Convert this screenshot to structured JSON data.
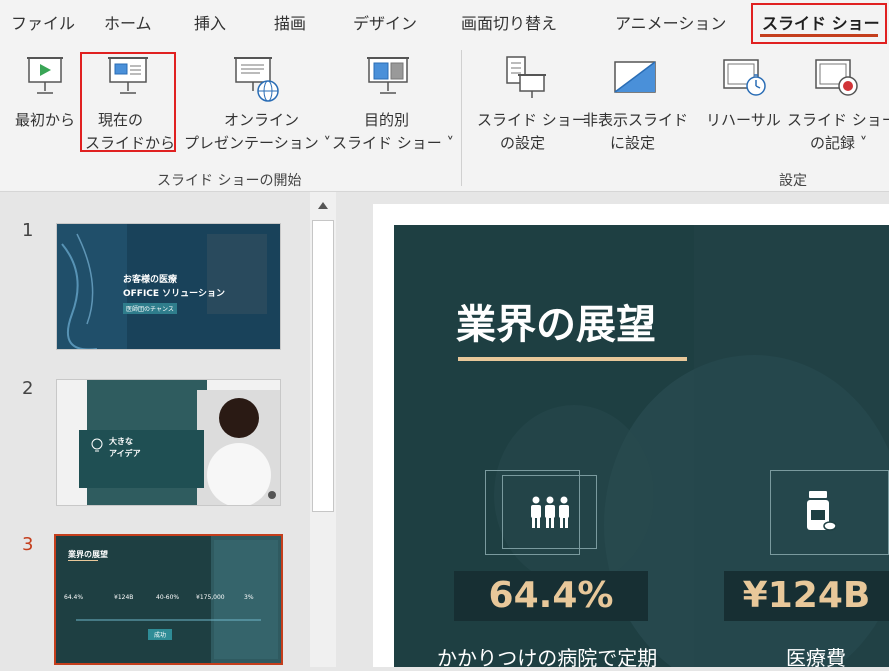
{
  "tabs": [
    "ファイル",
    "ホーム",
    "挿入",
    "描画",
    "デザイン",
    "画面切り替え",
    "アニメーション",
    "スライド ショー"
  ],
  "ribbon": {
    "from_beginning": [
      "最初から"
    ],
    "from_current": [
      "現在の",
      "スライドから"
    ],
    "online": [
      "オンライン",
      "プレゼンテーション ˅"
    ],
    "custom": [
      "目的別",
      "スライド ショー ˅"
    ],
    "setup": [
      "スライド ショー",
      "の設定"
    ],
    "hide": [
      "非表示スライド",
      "に設定"
    ],
    "rehearse": [
      "リハーサル"
    ],
    "record": [
      "スライド ショー",
      "の記録 ˅"
    ],
    "group_start": "スライド ショーの開始",
    "group_setup": "設定"
  },
  "slide_numbers": [
    "1",
    "2",
    "3"
  ],
  "thumbs": {
    "t1_title": "お客様の医療",
    "t1_sub": "OFFICE ソリューション",
    "t1_badge": "医師団のチャンス",
    "t2_title": "大きな",
    "t2_sub": "アイデア",
    "t3_title": "業界の展望",
    "t3_stats": [
      "64.4%",
      "¥124B",
      "40-60%",
      "¥175,000",
      "3%"
    ],
    "t3_badge": "成功"
  },
  "main_slide": {
    "title": "業界の展望",
    "stat1": "64.4%",
    "stat2": "¥124B",
    "caption1": "かかりつけの病院で定期",
    "caption2": "医療費"
  },
  "colors": {
    "accent": "#c43e1c",
    "slide_bg": "#1e3f42",
    "stat_text": "#e8c89a",
    "highlight": "#e02020"
  }
}
